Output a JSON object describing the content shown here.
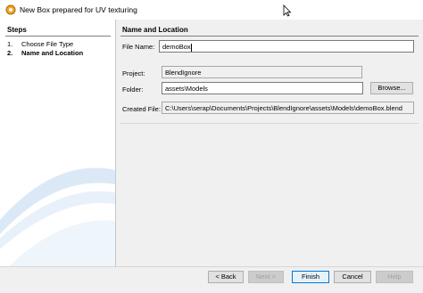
{
  "window": {
    "title": "New Box prepared for UV texturing",
    "icon": "app-gear-icon"
  },
  "steps": {
    "heading": "Steps",
    "items": [
      {
        "num": "1.",
        "label": "Choose File Type",
        "active": false
      },
      {
        "num": "2.",
        "label": "Name and Location",
        "active": true
      }
    ]
  },
  "panel": {
    "heading": "Name and Location",
    "file_name_label": "File Name:",
    "file_name_value": "demoBox",
    "project_label": "Project:",
    "project_value": "BlendIgnore",
    "folder_label": "Folder:",
    "folder_value": "assets\\Models",
    "browse_label": "Browse...",
    "created_file_label": "Created File:",
    "created_file_value": "C:\\Users\\serap\\Documents\\Projects\\BlendIgnore\\assets\\Models\\demoBox.blend"
  },
  "buttons": {
    "back": "< Back",
    "next": "Next >",
    "finish": "Finish",
    "cancel": "Cancel",
    "help": "Help"
  }
}
